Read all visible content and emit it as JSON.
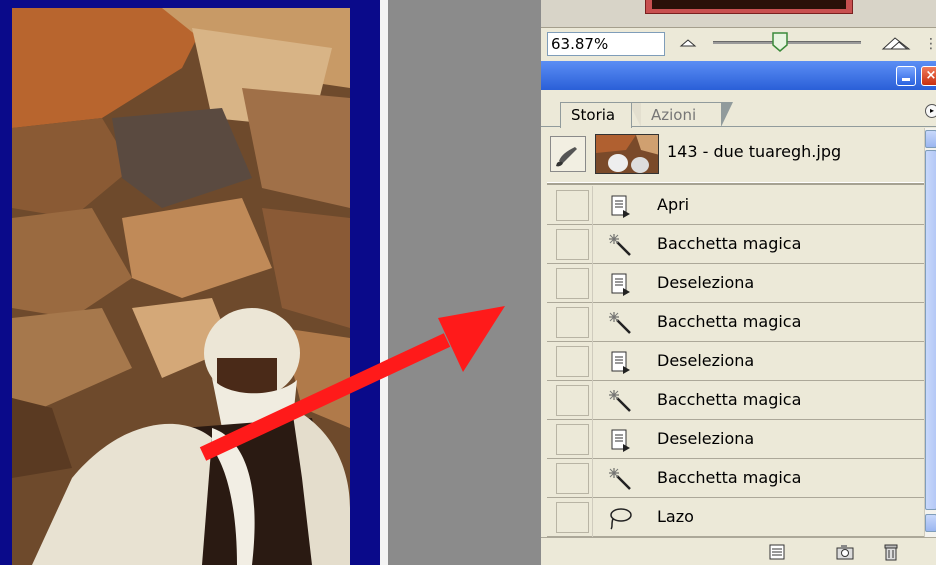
{
  "navigator": {
    "zoom_value": "63.87%",
    "zoom_slider_fraction": 0.45
  },
  "history_panel": {
    "tabs": [
      {
        "label": "Storia",
        "active": true
      },
      {
        "label": "Azioni",
        "active": false
      }
    ],
    "snapshot": {
      "name": "143 - due tuaregh.jpg"
    },
    "steps": [
      {
        "label": "Apri",
        "icon": "document-icon"
      },
      {
        "label": "Bacchetta magica",
        "icon": "magic-wand-icon"
      },
      {
        "label": "Deseleziona",
        "icon": "document-icon"
      },
      {
        "label": "Bacchetta magica",
        "icon": "magic-wand-icon"
      },
      {
        "label": "Deseleziona",
        "icon": "document-icon"
      },
      {
        "label": "Bacchetta magica",
        "icon": "magic-wand-icon"
      },
      {
        "label": "Deseleziona",
        "icon": "document-icon"
      },
      {
        "label": "Bacchetta magica",
        "icon": "magic-wand-icon"
      },
      {
        "label": "Lazo",
        "icon": "lasso-icon"
      }
    ]
  },
  "colors": {
    "background": "#0a0a8a",
    "arrow": "#ff1a1a",
    "panel": "#ece9d8",
    "titlebar": "#2a5fd8"
  }
}
